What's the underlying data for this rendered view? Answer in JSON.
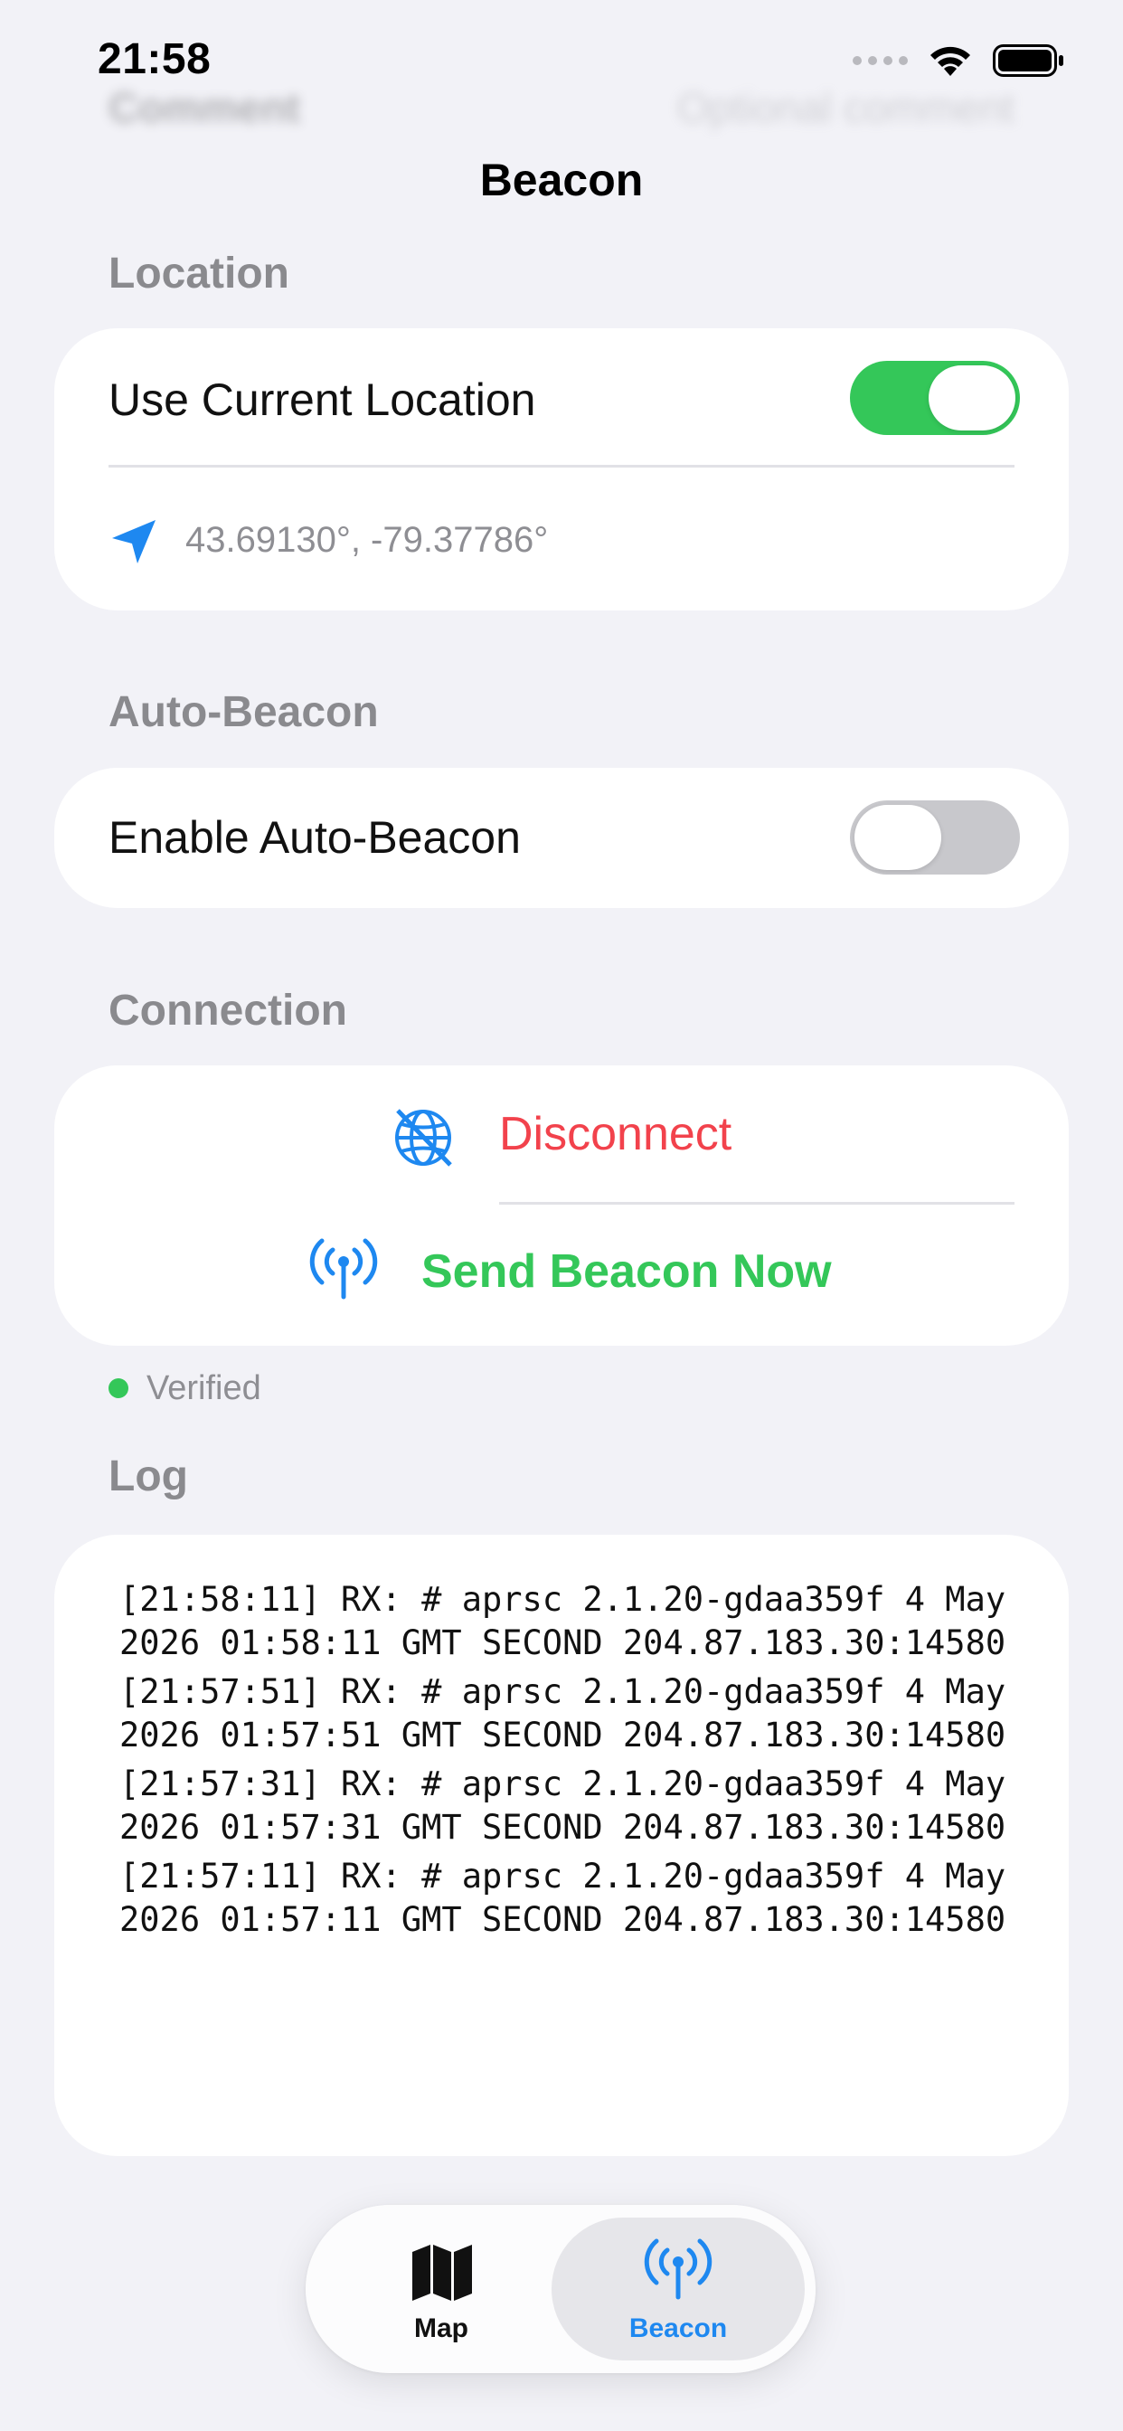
{
  "status_bar": {
    "time": "21:58"
  },
  "ghost_row": {
    "label": "Comment",
    "placeholder": "Optional comment"
  },
  "nav": {
    "title": "Beacon"
  },
  "location": {
    "header": "Location",
    "use_current_label": "Use Current Location",
    "use_current_on": true,
    "coordinates": "43.69130°, -79.37786°"
  },
  "auto_beacon": {
    "header": "Auto-Beacon",
    "enable_label": "Enable Auto-Beacon",
    "enabled": false
  },
  "connection": {
    "header": "Connection",
    "disconnect_label": "Disconnect",
    "send_label": "Send Beacon Now",
    "status": "Verified"
  },
  "log": {
    "header": "Log",
    "entries": [
      "[21:58:11] RX: # aprsc 2.1.20-gdaa359f 4 May 2026 01:58:11 GMT SECOND 204.87.183.30:14580",
      "[21:57:51] RX: # aprsc 2.1.20-gdaa359f 4 May 2026 01:57:51 GMT SECOND 204.87.183.30:14580",
      "[21:57:31] RX: # aprsc 2.1.20-gdaa359f 4 May 2026 01:57:31 GMT SECOND 204.87.183.30:14580",
      "[21:57:11] RX: # aprsc 2.1.20-gdaa359f 4 May 2026 01:57:11 GMT SECOND 204.87.183.30:14580"
    ]
  },
  "tabbar": {
    "tabs": [
      {
        "label": "Map",
        "icon": "map-icon",
        "selected": false
      },
      {
        "label": "Beacon",
        "icon": "antenna-icon",
        "selected": true
      }
    ]
  },
  "colors": {
    "accent_blue": "#1e88f0",
    "green": "#34c759",
    "red": "#f2424c",
    "background": "#f2f2f7"
  }
}
